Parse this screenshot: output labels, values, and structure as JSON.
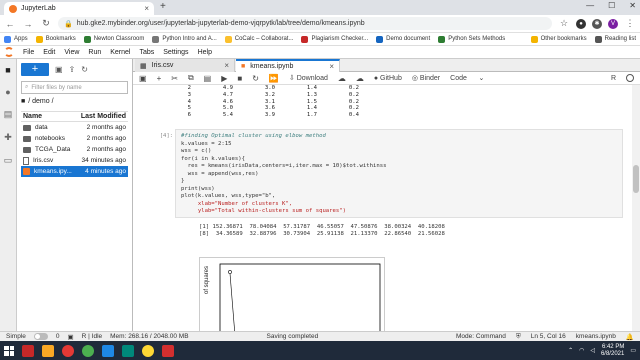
{
  "browser": {
    "tab_title": "JupyterLab",
    "url": "hub.gke2.mybinder.org/user/jupyterlab-jupyterlab-demo-vjqrpytk/lab/tree/demo/kmeans.ipynb",
    "profile_initial": "V",
    "bookmarks": [
      "Apps",
      "Bookmarks",
      "Newton Classroom",
      "Python Intro and A...",
      "CoCalc – Collaborat...",
      "Plagiarism Checker...",
      "Demo document",
      "Python Sets Methods",
      "Other bookmarks",
      "Reading list"
    ]
  },
  "jupyter_menu": [
    "File",
    "Edit",
    "View",
    "Run",
    "Kernel",
    "Tabs",
    "Settings",
    "Help"
  ],
  "file_browser": {
    "filter_placeholder": "Filter files by name",
    "breadcrumb": "/ demo /",
    "col_name": "Name",
    "col_modified": "Last Modified",
    "files": [
      {
        "name": "data",
        "modified": "2 months ago",
        "kind": "folder",
        "selected": false
      },
      {
        "name": "notebooks",
        "modified": "2 months ago",
        "kind": "folder",
        "selected": false
      },
      {
        "name": "TCGA_Data",
        "modified": "2 months ago",
        "kind": "folder",
        "selected": false
      },
      {
        "name": "Iris.csv",
        "modified": "34 minutes ago",
        "kind": "file",
        "selected": false
      },
      {
        "name": "kmeans.ipy...",
        "modified": "4 minutes ago",
        "kind": "notebook",
        "selected": true
      }
    ]
  },
  "doc_tabs": [
    {
      "label": "Iris.csv",
      "active": false
    },
    {
      "label": "kmeans.ipynb",
      "active": true
    }
  ],
  "nb_toolbar": {
    "download": "Download",
    "github": "GitHub",
    "binder": "Binder",
    "cell_type": "Code",
    "kernel": "R"
  },
  "df_rows": [
    [
      "2",
      "4.9",
      "3.0",
      "1.4",
      "0.2"
    ],
    [
      "3",
      "4.7",
      "3.2",
      "1.3",
      "0.2"
    ],
    [
      "4",
      "4.6",
      "3.1",
      "1.5",
      "0.2"
    ],
    [
      "5",
      "5.0",
      "3.6",
      "1.4",
      "0.2"
    ],
    [
      "6",
      "5.4",
      "3.9",
      "1.7",
      "0.4"
    ]
  ],
  "cell": {
    "prompt": "[4]:",
    "comment": "#finding Optimal cluster using elbow method",
    "line2": "k.values = 2:15",
    "line3": "wss = c()",
    "line4": "for(i in k.values){",
    "line5": "  res = kmeans(irisData,centers=i,iter.max = 10)$tot.withinss",
    "line6": "  wss = append(wss,res)",
    "line7": "}",
    "line8": "print(wss)",
    "line9": "plot(k.values, wss,type=\"b\",",
    "line10": "     xlab=\"Number of clusters K\",",
    "line11": "     ylab=\"Total within-clusters sum of squares\")",
    "out1": "[1] 152.36871  78.04084  57.31787  46.55057  47.50876  38.00324  40.18208",
    "out2": "[8]  34.36589  32.88796  30.73904  25.91138  21.13370  22.86540  21.56028"
  },
  "plot": {
    "ylabel_partial": "of squares"
  },
  "status_bar": {
    "mode_label": "Simple",
    "counts": "0",
    "kernel_state": "R | Idle",
    "memory": "Mem: 268.16 / 2048.00 MB",
    "saving": "Saving completed",
    "mode": "Mode: Command",
    "position": "Ln 5, Col 16",
    "file": "kmeans.ipynb"
  },
  "taskbar": {
    "time": "6:42 PM",
    "date": "6/8/2021"
  }
}
